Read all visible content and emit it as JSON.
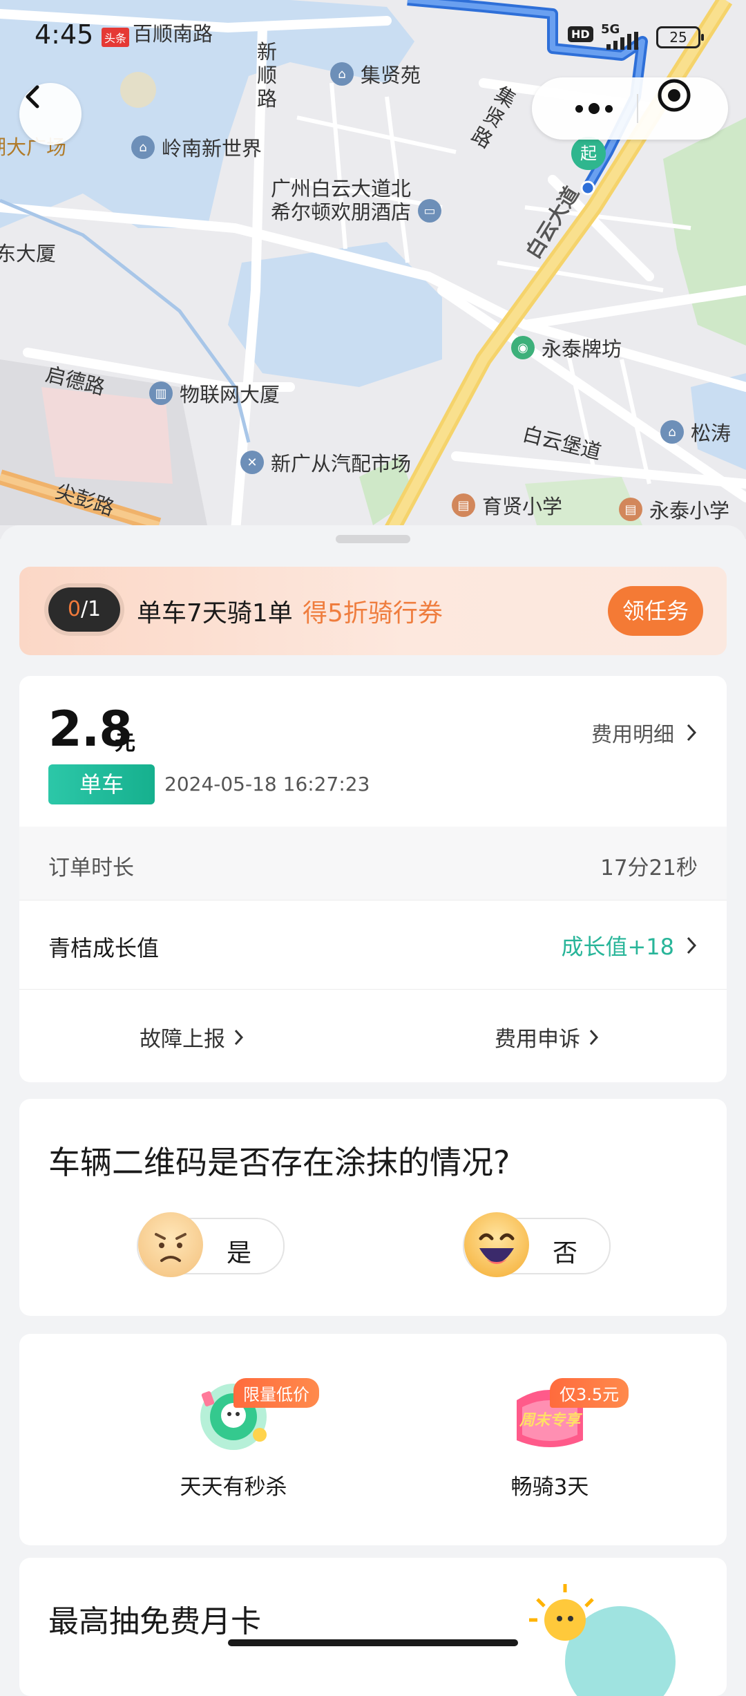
{
  "status_bar": {
    "time": "4:45",
    "notif_badge": "头条",
    "hd": "HD",
    "network": "5G",
    "battery": "25"
  },
  "map": {
    "roads": [
      "百顺南路",
      "新顺路",
      "集贤路",
      "白云大道",
      "启德路",
      "白云堡道",
      "尖彭路"
    ],
    "pois": [
      "集贤苑",
      "岭南新世界",
      "广州白云大道北",
      "希尔顿欢朋酒店",
      "物联网大厦",
      "永泰牌坊",
      "新广从汽配市场",
      "育贤小学",
      "永泰小学",
      "松涛"
    ],
    "edge_labels": [
      "湖大广场",
      "东大厦"
    ],
    "start_marker": "起",
    "icons": [
      "back-arrow-icon",
      "more-dots-icon",
      "target-icon"
    ]
  },
  "task_banner": {
    "progress_current": "0",
    "progress_total": "/1",
    "title": "单车7天骑1单",
    "reward": "得5折骑行券",
    "button": "领任务"
  },
  "fee": {
    "amount": "2.8",
    "unit": "元",
    "detail_link": "费用明细",
    "vehicle_tag": "单车",
    "datetime": "2024-05-18 16:27:23",
    "duration_label": "订单时长",
    "duration_value": "17分21秒",
    "growth_label": "青桔成长值",
    "growth_value": "成长值+18",
    "action_fault": "故障上报",
    "action_appeal": "费用申诉"
  },
  "survey": {
    "question": "车辆二维码是否存在涂抹的情况?",
    "yes": "是",
    "no": "否"
  },
  "promos": [
    {
      "flag": "限量低价",
      "name": "天天有秒杀"
    },
    {
      "flag": "仅3.5元",
      "name": "畅骑3天",
      "art_text": "周末专享"
    }
  ],
  "lottery": {
    "title": "最高抽免费月卡"
  },
  "colors": {
    "accent_orange": "#f47a35",
    "accent_green": "#16b08e",
    "growth_green": "#28b599"
  }
}
